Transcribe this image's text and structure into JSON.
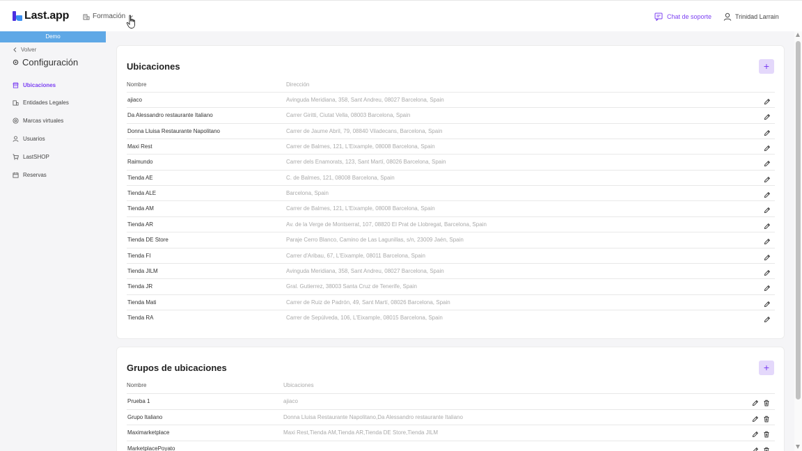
{
  "header": {
    "logo_text": "Last.app",
    "org_name": "Formación",
    "support_label": "Chat de soporte",
    "user_name": "Trinidad Larrain"
  },
  "sidebar": {
    "environment_label": "Demo",
    "back_label": "Volver",
    "title": "Configuración",
    "items": [
      {
        "label": "Ubicaciones",
        "icon": "store-icon",
        "active": true
      },
      {
        "label": "Entidades Legales",
        "icon": "building-icon",
        "active": false
      },
      {
        "label": "Marcas virtuales",
        "icon": "at-icon",
        "active": false
      },
      {
        "label": "Usuarios",
        "icon": "user-icon",
        "active": false
      },
      {
        "label": "LastSHOP",
        "icon": "cart-icon",
        "active": false
      },
      {
        "label": "Reservas",
        "icon": "calendar-icon",
        "active": false
      }
    ]
  },
  "locations": {
    "title": "Ubicaciones",
    "add_label": "+",
    "columns": [
      "Nombre",
      "Dirección"
    ],
    "rows": [
      {
        "name": "ajiaco",
        "address": "Avinguda Meridiana, 358, Sant Andreu, 08027 Barcelona, Spain"
      },
      {
        "name": "Da Alessandro restaurante Italiano",
        "address": "Carrer Giritti, Ciutat Vella, 08003 Barcelona, Spain"
      },
      {
        "name": "Donna Lluisa Restaurante Napolitano",
        "address": "Carrer de Jaume Abril, 79, 08840 Viladecans, Barcelona, Spain"
      },
      {
        "name": "Maxi Rest",
        "address": "Carrer de Balmes, 121, L'Eixample, 08008 Barcelona, Spain"
      },
      {
        "name": "Raimundo",
        "address": "Carrer dels Enamorats, 123, Sant Martí, 08026 Barcelona, Spain"
      },
      {
        "name": "Tienda AE",
        "address": "C. de Balmes, 121, 08008 Barcelona, Spain"
      },
      {
        "name": "Tienda ALE",
        "address": "Barcelona, Spain"
      },
      {
        "name": "Tienda AM",
        "address": "Carrer de Balmes, 121, L'Eixample, 08008 Barcelona, Spain"
      },
      {
        "name": "Tienda AR",
        "address": "Av. de la Verge de Montserrat, 107, 08820 El Prat de Llobregat, Barcelona, Spain"
      },
      {
        "name": "Tienda DE Store",
        "address": "Paraje Cerro Blanco, Camino de Las Lagunillas, s/n, 23009 Jaén, Spain"
      },
      {
        "name": "Tienda FI",
        "address": "Carrer d'Aribau, 67, L'Eixample, 08011 Barcelona, Spain"
      },
      {
        "name": "Tienda JILM",
        "address": "Avinguda Meridiana, 358, Sant Andreu, 08027 Barcelona, Spain"
      },
      {
        "name": "Tienda JR",
        "address": "Gral. Gutierrez, 38003 Santa Cruz de Tenerife, Spain"
      },
      {
        "name": "Tienda Mati",
        "address": "Carrer de Ruiz de Padrón, 49, Sant Martí, 08026 Barcelona, Spain"
      },
      {
        "name": "Tienda RA",
        "address": "Carrer de Sepúlveda, 106, L'Eixample, 08015 Barcelona, Spain"
      }
    ]
  },
  "groups": {
    "title": "Grupos de ubicaciones",
    "add_label": "+",
    "columns": [
      "Nombre",
      "Ubicaciones"
    ],
    "rows": [
      {
        "name": "Prueba 1",
        "locations": "ajiaco"
      },
      {
        "name": "Grupo Italiano",
        "locations": "Donna Lluisa Restaurante Napolitano,Da Alessandro restaurante Italiano"
      },
      {
        "name": "Maximarketplace",
        "locations": "Maxi Rest,Tienda AM,Tienda AR,Tienda DE Store,Tienda JILM"
      },
      {
        "name": "MarketplacePoyato",
        "locations": ""
      }
    ]
  },
  "colors": {
    "accent": "#7b3ff2",
    "demo_banner": "#5fa8e6"
  }
}
